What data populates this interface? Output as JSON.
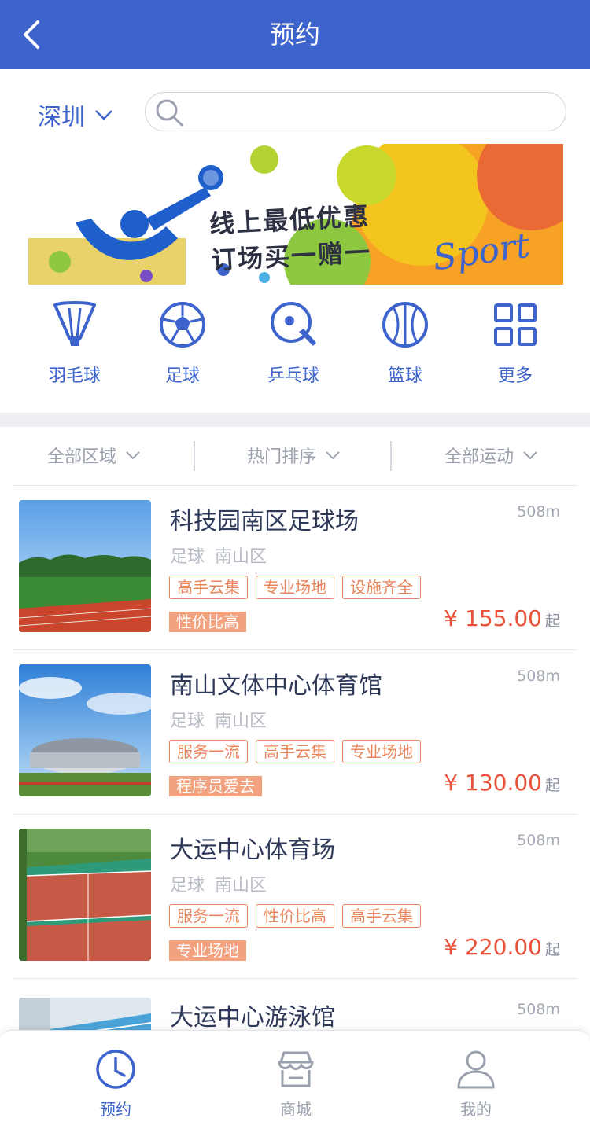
{
  "header": {
    "title": "预约"
  },
  "search": {
    "city": "深圳",
    "placeholder": ""
  },
  "banner": {
    "line1": "线上最低优惠",
    "line2": "订场买一赠一",
    "word": "Sport"
  },
  "categories": [
    {
      "label": "羽毛球",
      "icon": "badminton-icon"
    },
    {
      "label": "足球",
      "icon": "football-icon"
    },
    {
      "label": "乒乓球",
      "icon": "pingpong-icon"
    },
    {
      "label": "篮球",
      "icon": "basketball-icon"
    },
    {
      "label": "更多",
      "icon": "grid-icon"
    }
  ],
  "filters": [
    {
      "label": "全部区域"
    },
    {
      "label": "热门排序"
    },
    {
      "label": "全部运动"
    }
  ],
  "venues": [
    {
      "name": "科技园南区足球场",
      "distance": "508m",
      "sport": "足球",
      "district": "南山区",
      "tags": [
        "高手云集",
        "专业场地",
        "设施齐全"
      ],
      "badge": "性价比高",
      "price": "¥ 155.00",
      "suffix": "起"
    },
    {
      "name": "南山文体中心体育馆",
      "distance": "508m",
      "sport": "足球",
      "district": "南山区",
      "tags": [
        "服务一流",
        "高手云集",
        "专业场地"
      ],
      "badge": "程序员爱去",
      "price": "¥ 130.00",
      "suffix": "起"
    },
    {
      "name": "大运中心体育场",
      "distance": "508m",
      "sport": "足球",
      "district": "南山区",
      "tags": [
        "服务一流",
        "性价比高",
        "高手云集"
      ],
      "badge": "专业场地",
      "price": "¥ 220.00",
      "suffix": "起"
    },
    {
      "name": "大运中心游泳馆",
      "distance": "508m"
    }
  ],
  "tabbar": [
    {
      "label": "预约",
      "icon": "clock-icon",
      "active": true
    },
    {
      "label": "商城",
      "icon": "store-icon",
      "active": false
    },
    {
      "label": "我的",
      "icon": "user-icon",
      "active": false
    }
  ],
  "colors": {
    "primary": "#3d63cc",
    "tag": "#e9855a",
    "badge": "#f2a27e",
    "price": "#e8503a"
  }
}
